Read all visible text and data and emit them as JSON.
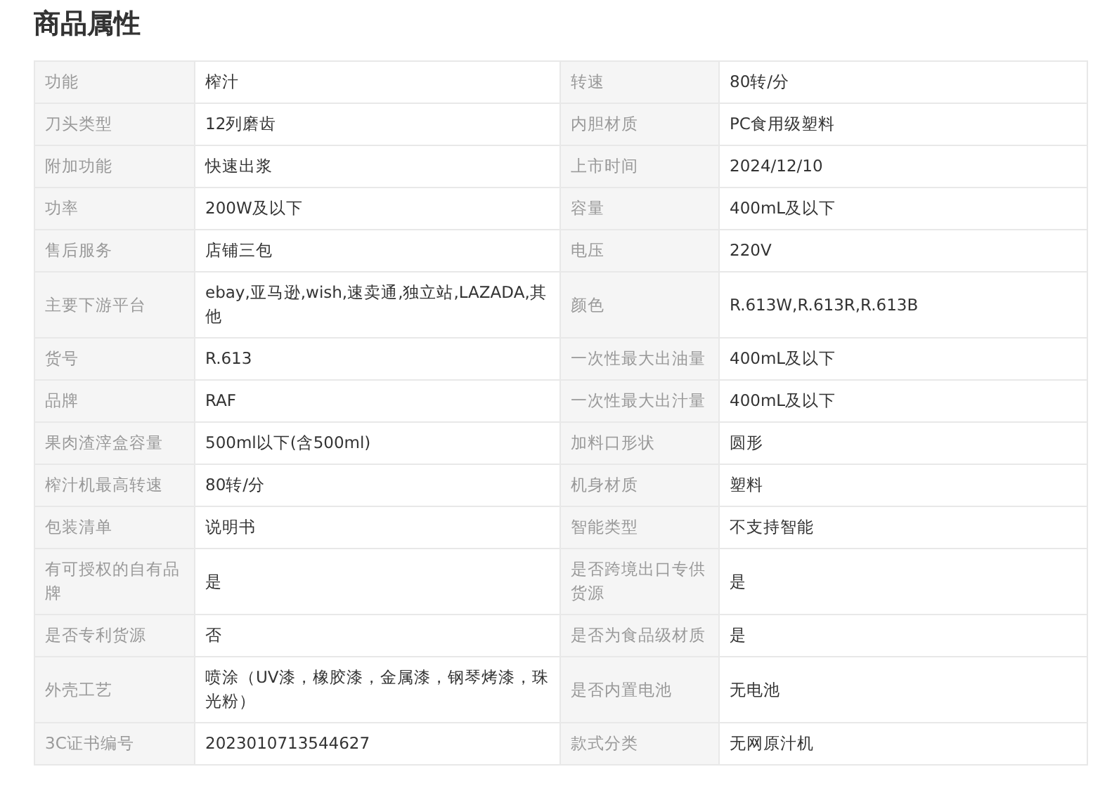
{
  "title": "商品属性",
  "attributes": [
    {
      "name": "功能",
      "value": "榨汁"
    },
    {
      "name": "转速",
      "value": "80转/分"
    },
    {
      "name": "刀头类型",
      "value": "12列磨齿"
    },
    {
      "name": "内胆材质",
      "value": "PC食用级塑料"
    },
    {
      "name": "附加功能",
      "value": "快速出浆"
    },
    {
      "name": "上市时间",
      "value": "2024/12/10"
    },
    {
      "name": "功率",
      "value": "200W及以下"
    },
    {
      "name": "容量",
      "value": "400mL及以下"
    },
    {
      "name": "售后服务",
      "value": "店铺三包"
    },
    {
      "name": "电压",
      "value": "220V"
    },
    {
      "name": "主要下游平台",
      "value": "ebay,亚马逊,wish,速卖通,独立站,LAZADA,其他"
    },
    {
      "name": "颜色",
      "value": "R.613W,R.613R,R.613B"
    },
    {
      "name": "货号",
      "value": "R.613"
    },
    {
      "name": "一次性最大出油量",
      "value": "400mL及以下"
    },
    {
      "name": "品牌",
      "value": "RAF"
    },
    {
      "name": "一次性最大出汁量",
      "value": "400mL及以下"
    },
    {
      "name": "果肉渣滓盒容量",
      "value": "500ml以下(含500ml)"
    },
    {
      "name": "加料口形状",
      "value": "圆形"
    },
    {
      "name": "榨汁机最高转速",
      "value": "80转/分"
    },
    {
      "name": "机身材质",
      "value": "塑料"
    },
    {
      "name": "包装清单",
      "value": "说明书"
    },
    {
      "name": "智能类型",
      "value": "不支持智能"
    },
    {
      "name": "有可授权的自有品牌",
      "value": "是"
    },
    {
      "name": "是否跨境出口专供货源",
      "value": "是"
    },
    {
      "name": "是否专利货源",
      "value": "否"
    },
    {
      "name": "是否为食品级材质",
      "value": "是"
    },
    {
      "name": "外壳工艺",
      "value": "喷涂（UV漆，橡胶漆，金属漆，钢琴烤漆，珠光粉）"
    },
    {
      "name": "是否内置电池",
      "value": "无电池"
    },
    {
      "name": "3C证书编号",
      "value": "2023010713544627"
    },
    {
      "name": "款式分类",
      "value": "无网原汁机"
    }
  ]
}
